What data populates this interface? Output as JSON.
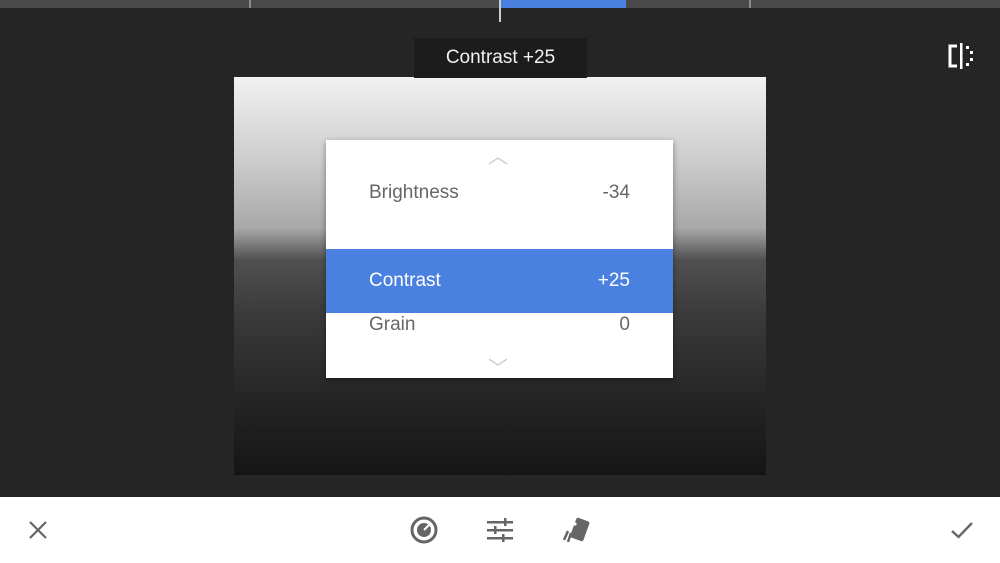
{
  "colors": {
    "accent": "#4a80e0",
    "toolbar_bg": "#ffffff",
    "canvas_bg": "#252525"
  },
  "progress_indicator": {
    "active_segment": 2,
    "segment_count": 4
  },
  "tooltip": "Contrast +25",
  "compare_icon": "compare-split-icon",
  "menu": {
    "up_icon": "chevron-up-icon",
    "down_icon": "chevron-down-icon",
    "items": [
      {
        "label": "Brightness",
        "value": "-34"
      },
      {
        "label": "Contrast",
        "value": "+25",
        "selected": true
      },
      {
        "label": "Grain",
        "value": "0"
      }
    ]
  },
  "toolbar": {
    "cancel_icon": "close-icon",
    "tools": [
      "tune-dial-icon",
      "sliders-icon",
      "styles-cards-icon"
    ],
    "apply_icon": "check-icon"
  }
}
